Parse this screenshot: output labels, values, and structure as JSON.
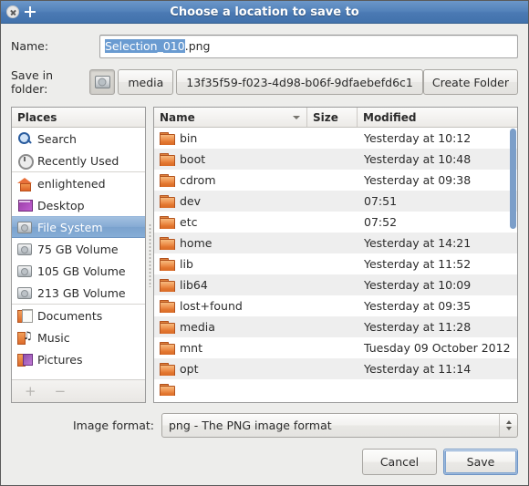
{
  "titlebar": {
    "title": "Choose a location to save to",
    "close_icon": "close-circle-icon",
    "plus_icon": "plus-icon"
  },
  "name_row": {
    "label": "Name:",
    "selected_text": "Selection_010",
    "remaining_text": ".png",
    "full_value": "Selection_010.png"
  },
  "folder_row": {
    "label": "Save in folder:",
    "drive_icon": "hard-drive-icon",
    "path_buttons": [
      {
        "label": "media",
        "active": false
      },
      {
        "label": "13f35f59-f023-4d98-b06f-9dfaebefd6c1",
        "active": false
      }
    ],
    "create_folder_label": "Create Folder"
  },
  "places": {
    "header": "Places",
    "items": [
      {
        "label": "Search",
        "icon": "search-icon",
        "icon_class": "ico-search",
        "selected": false,
        "separator": false
      },
      {
        "label": "Recently Used",
        "icon": "recent-clock-icon",
        "icon_class": "ico-recent",
        "selected": false,
        "separator": true
      },
      {
        "label": "enlightened",
        "icon": "home-folder-icon",
        "icon_class": "ico-home",
        "selected": false,
        "separator": false
      },
      {
        "label": "Desktop",
        "icon": "desktop-icon",
        "icon_class": "ico-desktop",
        "selected": false,
        "separator": false
      },
      {
        "label": "File System",
        "icon": "drive-icon",
        "icon_class": "ico-drive",
        "selected": true,
        "separator": false
      },
      {
        "label": "75 GB Volume",
        "icon": "drive-icon",
        "icon_class": "ico-drive",
        "selected": false,
        "separator": false
      },
      {
        "label": "105 GB Volume",
        "icon": "drive-icon",
        "icon_class": "ico-drive",
        "selected": false,
        "separator": false
      },
      {
        "label": "213 GB Volume",
        "icon": "drive-icon",
        "icon_class": "ico-drive",
        "selected": false,
        "separator": true
      },
      {
        "label": "Documents",
        "icon": "documents-folder-icon",
        "icon_class": "ico-docs",
        "selected": false,
        "separator": false
      },
      {
        "label": "Music",
        "icon": "music-folder-icon",
        "icon_class": "ico-music",
        "selected": false,
        "separator": false
      },
      {
        "label": "Pictures",
        "icon": "pictures-folder-icon",
        "icon_class": "ico-pics",
        "selected": false,
        "separator": false
      }
    ],
    "footer": {
      "add_label": "+",
      "remove_label": "−"
    }
  },
  "file_list": {
    "columns": [
      {
        "label": "Name",
        "sorted": true,
        "sort_direction": "descending"
      },
      {
        "label": "Size",
        "sorted": false
      },
      {
        "label": "Modified",
        "sorted": false
      }
    ],
    "rows": [
      {
        "name": "bin",
        "size": "",
        "modified": "Yesterday at 10:12"
      },
      {
        "name": "boot",
        "size": "",
        "modified": "Yesterday at 10:48"
      },
      {
        "name": "cdrom",
        "size": "",
        "modified": "Yesterday at 09:38"
      },
      {
        "name": "dev",
        "size": "",
        "modified": "07:51"
      },
      {
        "name": "etc",
        "size": "",
        "modified": "07:52"
      },
      {
        "name": "home",
        "size": "",
        "modified": "Yesterday at 14:21"
      },
      {
        "name": "lib",
        "size": "",
        "modified": "Yesterday at 11:52"
      },
      {
        "name": "lib64",
        "size": "",
        "modified": "Yesterday at 10:09"
      },
      {
        "name": "lost+found",
        "size": "",
        "modified": "Yesterday at 09:35"
      },
      {
        "name": "media",
        "size": "",
        "modified": "Yesterday at 11:28"
      },
      {
        "name": "mnt",
        "size": "",
        "modified": "Tuesday 09 October 2012"
      },
      {
        "name": "opt",
        "size": "",
        "modified": "Yesterday at 11:14"
      },
      {
        "name": "",
        "size": "",
        "modified": ""
      }
    ]
  },
  "format_row": {
    "label": "Image format:",
    "selected_value": "png - The PNG image format"
  },
  "actions": {
    "cancel_label": "Cancel",
    "save_label": "Save"
  },
  "colors": {
    "titlebar_blue": "#4a79b3",
    "selection_blue": "#85aad4",
    "scrollbar_blue": "#7b9ec9",
    "dialog_bg": "#ededeb",
    "row_alt": "#eeeeee"
  }
}
